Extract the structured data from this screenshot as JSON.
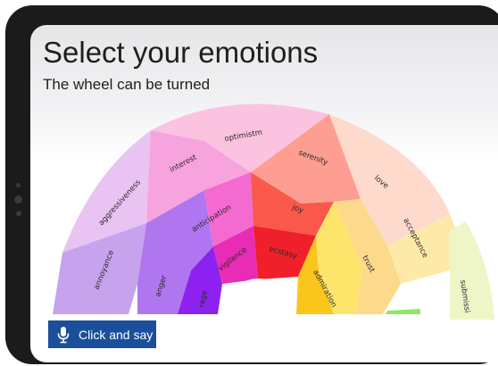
{
  "header": {
    "title": "Select your emotions",
    "subtitle": "The wheel can be turned"
  },
  "wheel": {
    "segments": {
      "optimism": "optimistm",
      "serenity": "serenity",
      "love": "love",
      "interest": "interest",
      "aggressiveness": "aggressiveness",
      "joy": "joy",
      "anticipation": "anticipation",
      "acceptance": "acceptance",
      "annoyance": "annoyance",
      "anger": "anger",
      "vigilance": "vigilance",
      "ecstasy": "ecstasy",
      "trust": "trust",
      "admiration": "admiration",
      "rage": "rage",
      "submission": "submissi"
    }
  },
  "voice_button": {
    "label": "Click and say",
    "color": "#1b4f9c",
    "icon": "microphone-icon"
  }
}
